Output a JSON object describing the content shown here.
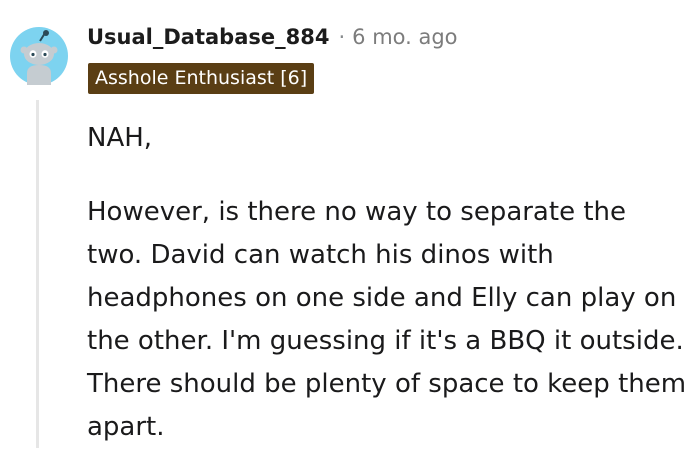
{
  "comment": {
    "username": "Usual_Database_884",
    "separator": "·",
    "timestamp": "6 mo. ago",
    "flair": "Asshole Enthusiast [6]",
    "avatar_icon": "reddit-snoo-avatar-icon",
    "paragraphs": [
      "NAH,",
      "However, is there no way to separate the two. David can watch his dinos with headphones on one side and Elly can play on the other. I'm guessing if it's a BBQ it outside. There should be plenty of space to keep them apart."
    ]
  },
  "colors": {
    "avatar_bg": "#7dd3f0",
    "flair_bg": "#5a3e14",
    "thread_line": "#e6e6e6",
    "meta_text": "#7c7c7c"
  }
}
